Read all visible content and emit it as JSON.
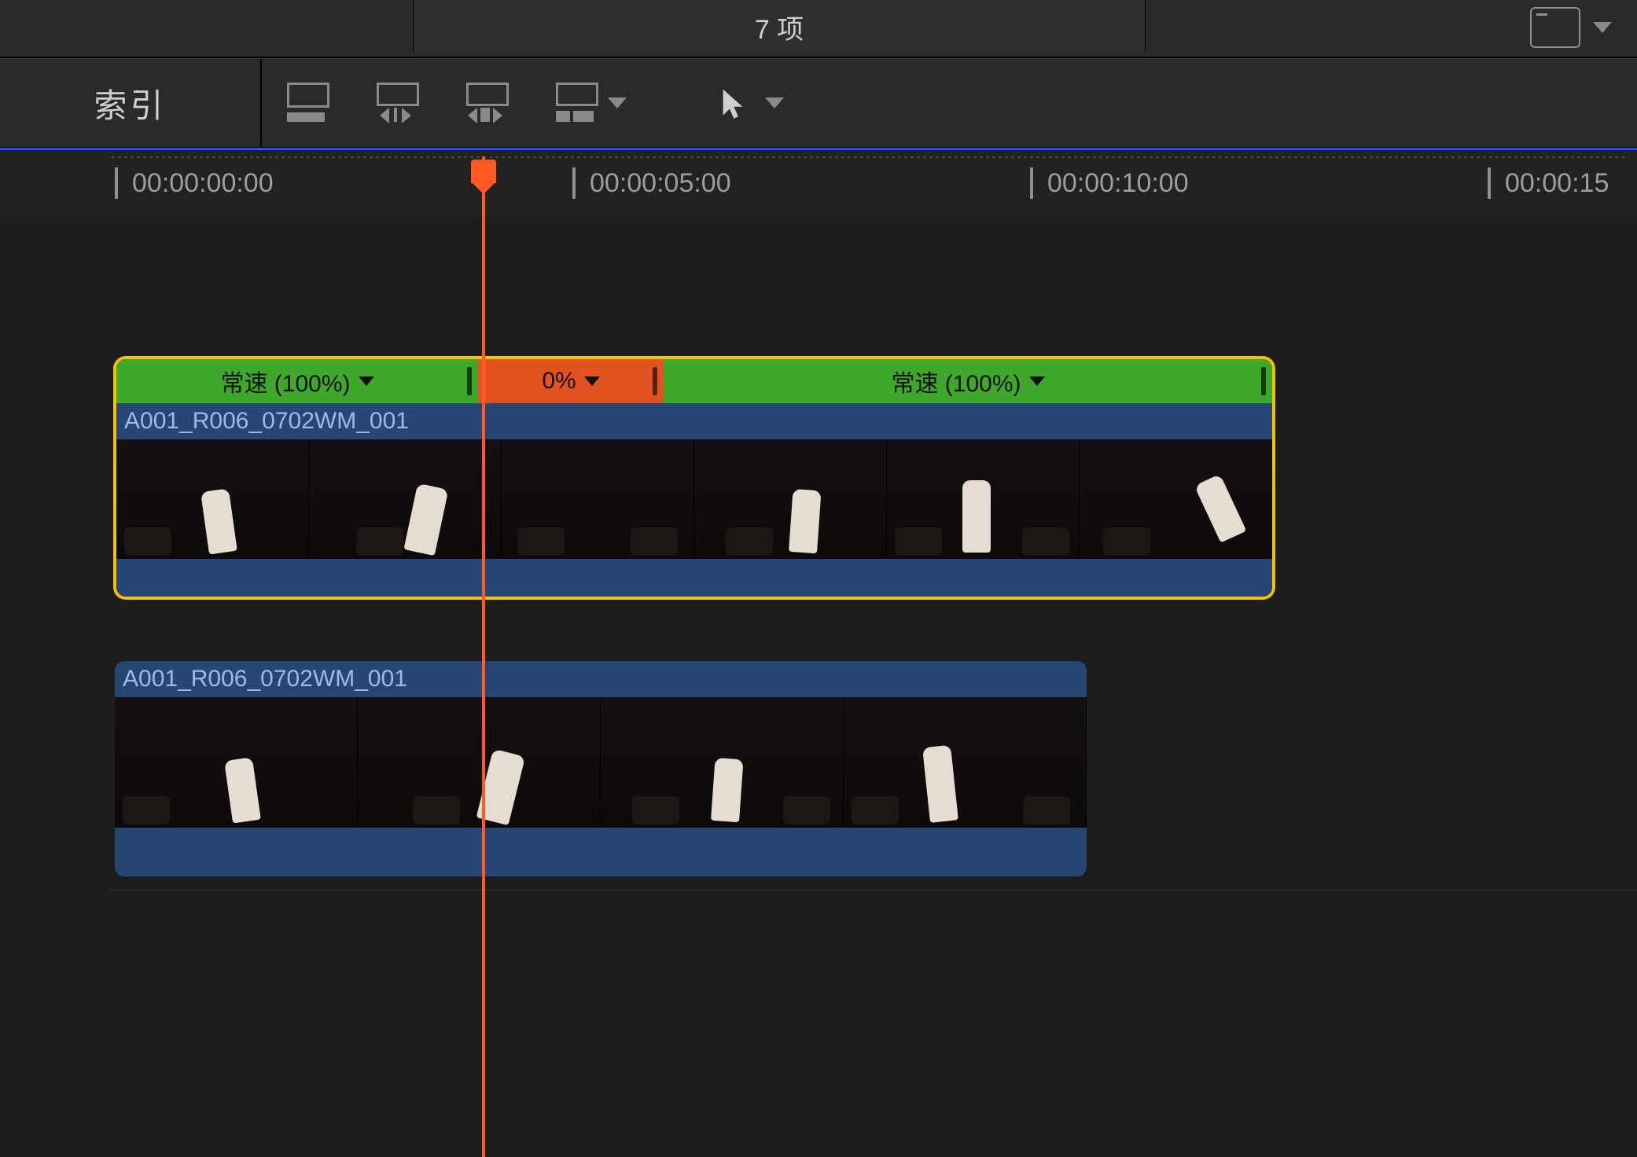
{
  "header": {
    "breadcrumb_text": "7 项"
  },
  "toolbar": {
    "index_label": "索引"
  },
  "ruler": {
    "ticks": {
      "t0": "00:00:00:00",
      "t1": "00:00:05:00",
      "t2": "00:00:10:00",
      "t3": "00:00:15"
    }
  },
  "clips": {
    "clip1": {
      "name": "A001_R006_0702WM_001",
      "speed": {
        "seg1_label": "常速 (100%)",
        "seg2_label": "0%",
        "seg3_label": "常速 (100%)"
      }
    },
    "clip2": {
      "name": "A001_R006_0702WM_001"
    }
  }
}
